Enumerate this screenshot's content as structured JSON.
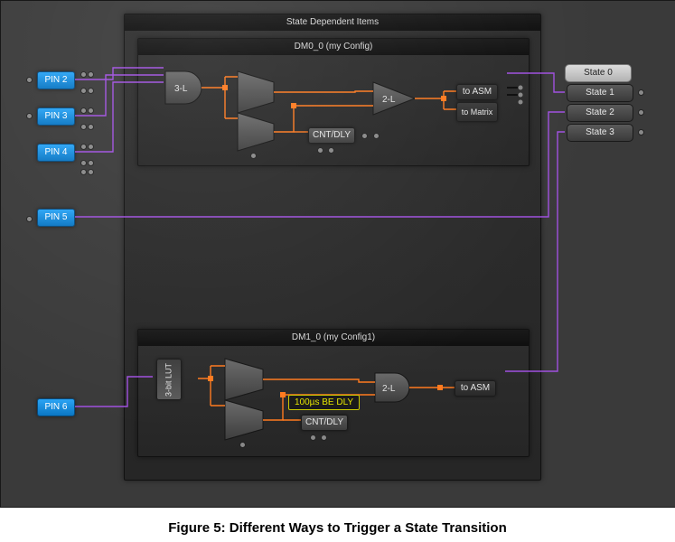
{
  "caption": "Figure 5: Different Ways to Trigger a State Transition",
  "outer": {
    "title": "State Dependent Items"
  },
  "dm0": {
    "title": "DM0_0 (my Config)",
    "lut3": "3-L",
    "lut2": "2-L",
    "cntdly": "CNT/DLY",
    "toasm": "to ASM",
    "tomatrix": "to Matrix"
  },
  "dm1": {
    "title": "DM1_0 (my Config1)",
    "lut": "3-bit LUT",
    "lut2": "2-L",
    "cntdly": "CNT/DLY",
    "toasm": "to ASM",
    "tooltip": "100µs BE DLY"
  },
  "pins": {
    "p2": "PIN 2",
    "p3": "PIN 3",
    "p4": "PIN 4",
    "p5": "PIN 5",
    "p6": "PIN 6"
  },
  "states": {
    "s0": "State 0",
    "s1": "State 1",
    "s2": "State 2",
    "s3": "State 3"
  }
}
